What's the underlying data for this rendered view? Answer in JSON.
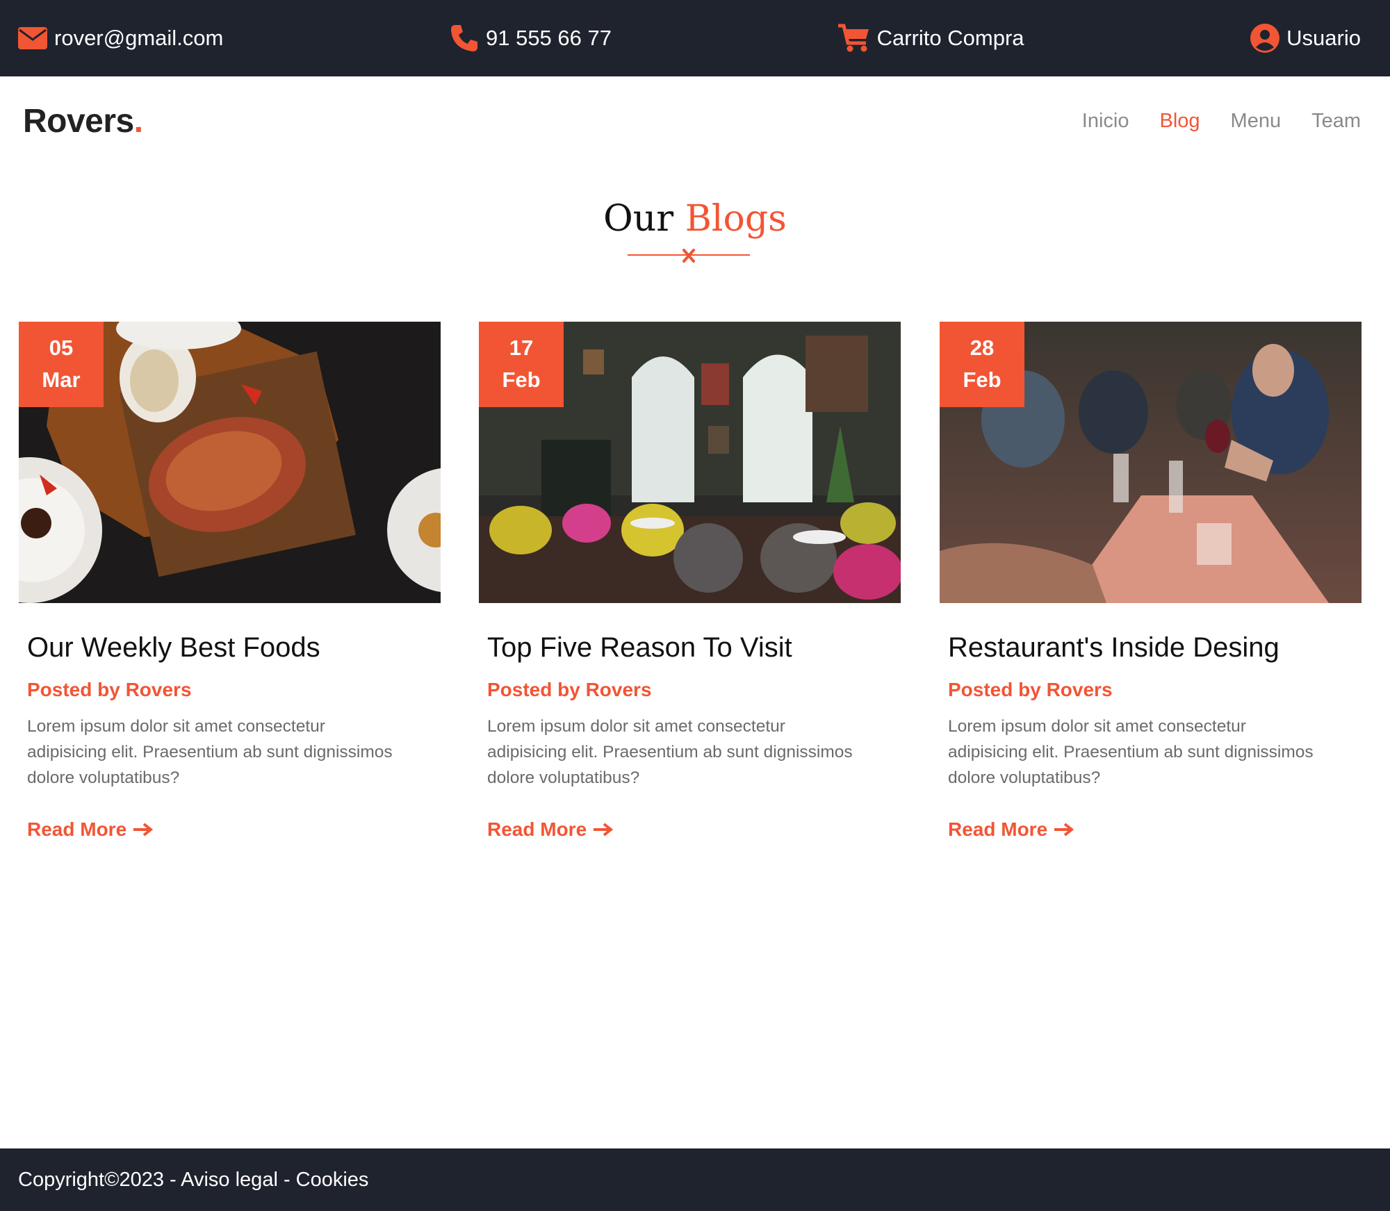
{
  "topbar": {
    "email": "rover@gmail.com",
    "phone": "91 555 66 77",
    "cart": "Carrito Compra",
    "user": "Usuario",
    "icons": [
      "envelope-icon",
      "phone-icon",
      "cart-icon",
      "user-circle-icon"
    ]
  },
  "nav": {
    "logo": "Rovers",
    "logo_dot": ".",
    "links": [
      {
        "label": "Inicio",
        "active": false
      },
      {
        "label": "Blog",
        "active": true
      },
      {
        "label": "Menu",
        "active": false
      },
      {
        "label": "Team",
        "active": false
      }
    ]
  },
  "section": {
    "title_prefix": "Our",
    "title_accent": "Blogs"
  },
  "blogs": [
    {
      "day": "05",
      "month": "Mar",
      "title": "Our Weekly Best Foods",
      "author": "Posted by Rovers",
      "text": "Lorem ipsum dolor sit amet consectetur adipisicing elit. Praesentium ab sunt dignissimos dolore voluptatibus?",
      "cta": "Read More",
      "image": "grilled-meat-on-board-photo"
    },
    {
      "day": "17",
      "month": "Feb",
      "title": "Top Five Reason To Visit",
      "author": "Posted by Rovers",
      "text": "Lorem ipsum dolor sit amet consectetur adipisicing elit. Praesentium ab sunt dignissimos dolore voluptatibus?",
      "cta": "Read More",
      "image": "restaurant-interior-photo"
    },
    {
      "day": "28",
      "month": "Feb",
      "title": "Restaurant's Inside Desing",
      "author": "Posted by Rovers",
      "text": "Lorem ipsum dolor sit amet consectetur adipisicing elit. Praesentium ab sunt dignissimos dolore voluptatibus?",
      "cta": "Read More",
      "image": "people-dining-photo"
    }
  ],
  "footer": {
    "text": "Copyright©2023 - Aviso legal - Cookies"
  },
  "colors": {
    "accent": "#f25534",
    "dark": "#1f232e"
  }
}
